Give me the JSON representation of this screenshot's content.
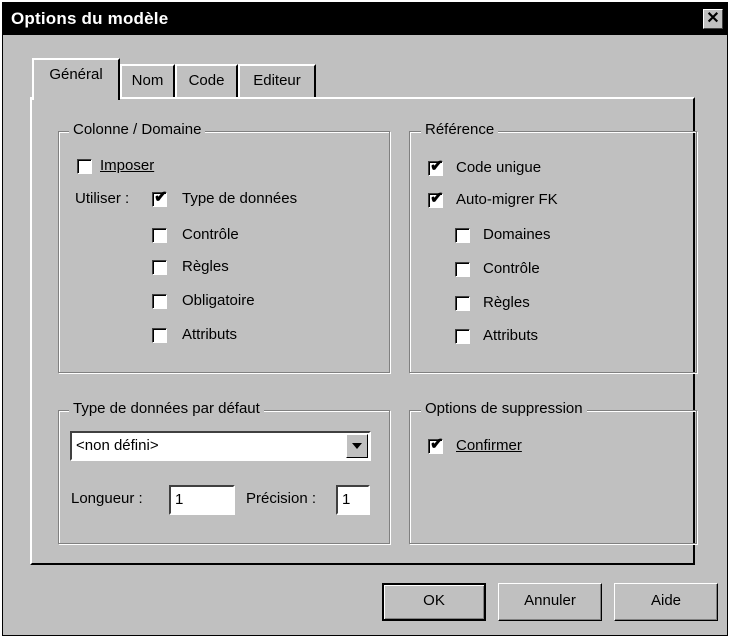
{
  "window": {
    "title": "Options du modèle",
    "close_label": "✕"
  },
  "tabs": [
    {
      "label": "Général",
      "active": true
    },
    {
      "label": "Nom",
      "active": false
    },
    {
      "label": "Code",
      "active": false
    },
    {
      "label": "Editeur",
      "active": false
    }
  ],
  "colonne_domaine": {
    "title": "Colonne / Domaine",
    "imposer": {
      "label": "Imposer",
      "checked": false
    },
    "utiliser_label": "Utiliser :",
    "type_donnees": {
      "label": "Type de données",
      "checked": true
    },
    "controle": {
      "label": "Contrôle",
      "checked": false
    },
    "regles": {
      "label": "Règles",
      "checked": false
    },
    "obligatoire": {
      "label": "Obligatoire",
      "checked": false
    },
    "attributs": {
      "label": "Attributs",
      "checked": false
    }
  },
  "reference": {
    "title": "Référence",
    "code_unique": {
      "label": "Code unigue",
      "checked": true
    },
    "auto_migrer": {
      "label": "Auto-migrer FK",
      "checked": true
    },
    "domaines": {
      "label": "Domaines",
      "checked": false
    },
    "controle": {
      "label": "Contrôle",
      "checked": false
    },
    "regles": {
      "label": "Règles",
      "checked": false
    },
    "attributs": {
      "label": "Attributs",
      "checked": false
    }
  },
  "type_defaut": {
    "title": "Type de données par défaut",
    "selected": "<non défini>",
    "longueur_label": "Longueur :",
    "longueur_value": "1",
    "precision_label": "Précision :",
    "precision_value": "1"
  },
  "suppression": {
    "title": "Options de suppression",
    "confirmer": {
      "label": "Confirmer",
      "checked": true
    }
  },
  "buttons": {
    "ok": "OK",
    "annuler": "Annuler",
    "aide": "Aide"
  },
  "check_glyph": "✔"
}
